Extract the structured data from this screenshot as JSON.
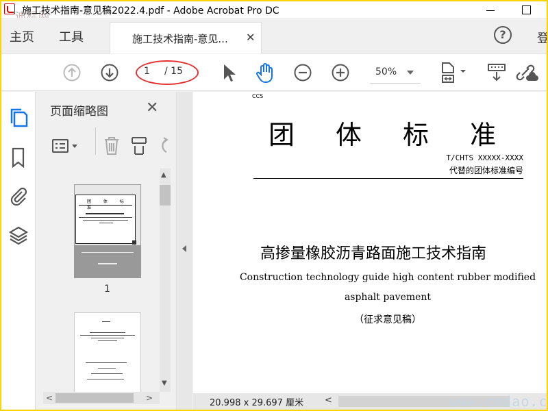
{
  "window": {
    "title": "施工技术指南-意见稿2022.4.pdf - Adobe Acrobat Pro DC",
    "watermark_top": "迪标网",
    "watermark_bottom": "www.cndao.com"
  },
  "tabs": {
    "home": "主页",
    "tools": "工具",
    "document_tab": "施工技术指南-意见...",
    "close": "✕",
    "help": "?",
    "signin_partial": "登"
  },
  "toolbar": {
    "page_current": "1",
    "page_total": "/ 15",
    "zoom": "50%",
    "icons": [
      "prev-page-icon",
      "next-page-icon",
      "select-arrow-icon",
      "hand-tool-icon",
      "zoom-out-icon",
      "zoom-in-icon",
      "page-fit-icon",
      "print-measure-icon",
      "share-link-icon"
    ],
    "colors": {
      "hand_tool": "#1473e6",
      "page_highlight": "#e53030"
    }
  },
  "sidebar": {
    "icons": [
      "pages-icon",
      "bookmark-icon",
      "attachment-icon",
      "layers-icon"
    ]
  },
  "thumbnails": {
    "title": "页面缩略图",
    "close": "✕",
    "page_label": "1",
    "thumb1_title": "团 体 标 准"
  },
  "document": {
    "ccs": "CCS",
    "main_title": "团体标准",
    "code": "T/CHTS XXXXX-XXXX",
    "replace": "代替的团体标准编号",
    "zh_title": "高掺量橡胶沥青路面施工技术指南",
    "en_title_line1": "Construction technology guide high content rubber modified",
    "en_title_line2": "asphalt pavement",
    "draft": "（征求意见稿）"
  },
  "status": {
    "page_size": "20.998 x 29.697 厘米"
  }
}
